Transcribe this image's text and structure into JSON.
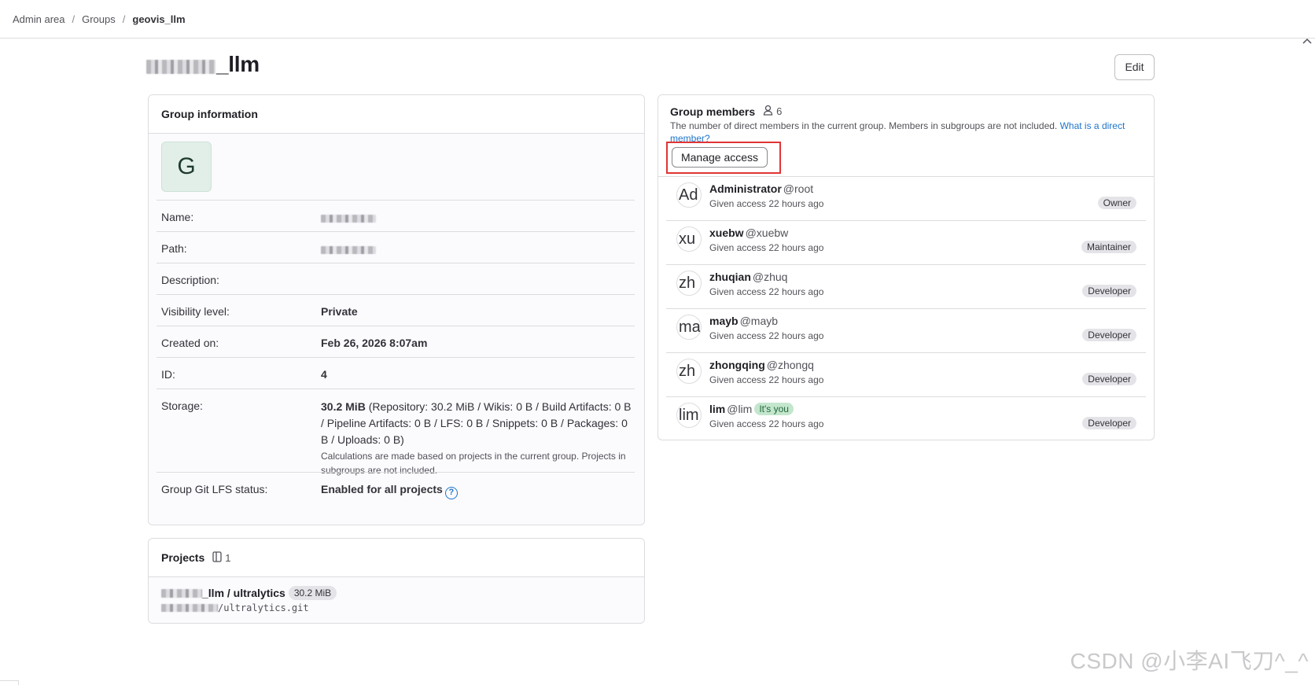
{
  "breadcrumb": {
    "items": [
      "Admin area",
      "Groups"
    ],
    "current": "geovis_llm"
  },
  "page": {
    "title_suffix": "_llm",
    "edit_label": "Edit"
  },
  "group_info": {
    "header": "Group information",
    "avatar_letter": "G",
    "rows": {
      "name_label": "Name:",
      "path_label": "Path:",
      "description_label": "Description:",
      "visibility_label": "Visibility level:",
      "visibility_value": "Private",
      "created_label": "Created on:",
      "created_value": "Feb 26, 2026 8:07am",
      "id_label": "ID:",
      "id_value": "4",
      "storage_label": "Storage:",
      "storage_total": "30.2 MiB",
      "storage_detail": " (Repository: 30.2 MiB / Wikis: 0 B / Build Artifacts: 0 B / Pipeline Artifacts: 0 B / LFS: 0 B / Snippets: 0 B / Packages: 0 B / Uploads: 0 B)",
      "storage_note": "Calculations are made based on projects in the current group. Projects in subgroups are not included.",
      "lfs_label": "Group Git LFS status:",
      "lfs_value": "Enabled for all projects"
    }
  },
  "projects": {
    "header": "Projects",
    "count": "1",
    "item": {
      "name_suffix": "_llm / ultralytics",
      "size": "30.2 MiB",
      "path_suffix": "/ultralytics.git"
    }
  },
  "members": {
    "header": "Group members",
    "count": "6",
    "description": "The number of direct members in the current group. Members in subgroups are not included. ",
    "description_link": "What is a direct member?",
    "manage_label": "Manage access",
    "list": [
      {
        "avatar": "Ad",
        "name": "Administrator",
        "username": "@root",
        "given": "Given access 22 hours ago",
        "role": "Owner"
      },
      {
        "avatar": "xu",
        "name": "xuebw",
        "username": "@xuebw",
        "given": "Given access 22 hours ago",
        "role": "Maintainer"
      },
      {
        "avatar": "zh",
        "name": "zhuqian",
        "username": "@zhuq",
        "given": "Given access 22 hours ago",
        "role": "Developer"
      },
      {
        "avatar": "ma",
        "name": "mayb",
        "username": "@mayb",
        "given": "Given access 22 hours ago",
        "role": "Developer"
      },
      {
        "avatar": "zh",
        "name": "zhongqing",
        "username": "@zhongq",
        "given": "Given access 22 hours ago",
        "role": "Developer"
      },
      {
        "avatar": "lim",
        "name": "lim",
        "username": "@lim",
        "badge": "It's you",
        "given": "Given access 22 hours ago",
        "role": "Developer"
      }
    ]
  },
  "watermark": "CSDN @小李AI飞刀^_^",
  "icons": {
    "members_count": "user-icon",
    "projects_count": "project-icon",
    "help": "question-circle-icon",
    "collapse": "chevron-up-icon"
  }
}
